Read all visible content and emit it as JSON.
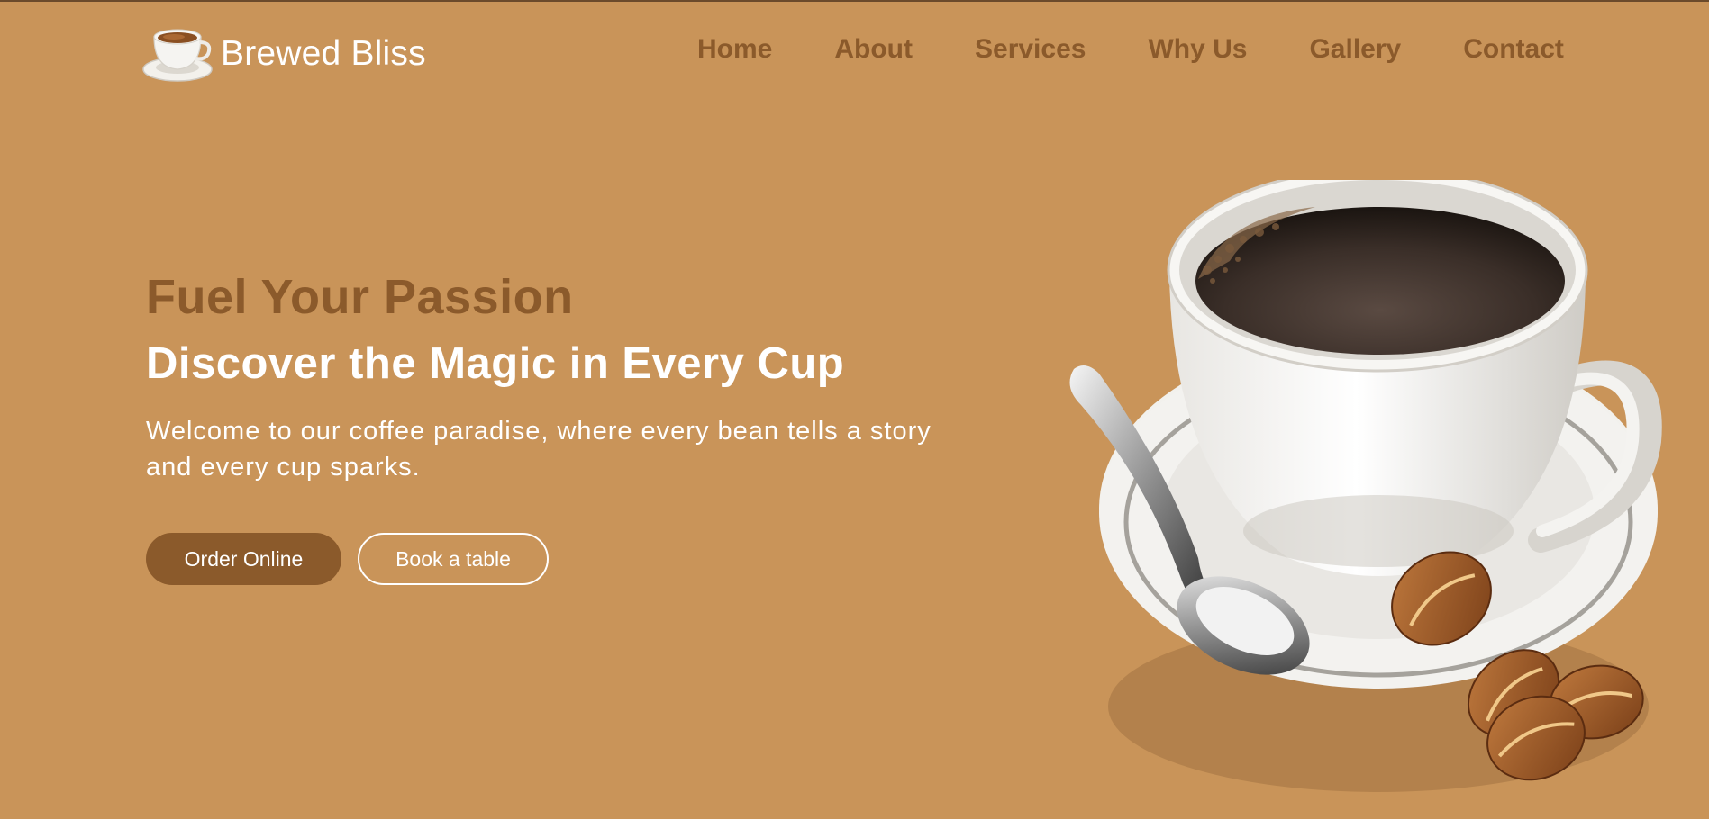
{
  "brand": {
    "name": "Brewed Bliss",
    "logo_icon": "coffee-cup-icon"
  },
  "nav": {
    "items": [
      {
        "label": "Home"
      },
      {
        "label": "About"
      },
      {
        "label": "Services"
      },
      {
        "label": "Why Us"
      },
      {
        "label": "Gallery"
      },
      {
        "label": "Contact"
      }
    ]
  },
  "hero": {
    "tagline": "Fuel Your Passion",
    "headline": "Discover the Magic in Every Cup",
    "description": "Welcome to our coffee paradise, where every bean tells a story and every cup sparks.",
    "primary_button": "Order Online",
    "secondary_button": "Book a table",
    "illustration_icon": "coffee-cup-with-spoon-and-beans-icon"
  },
  "colors": {
    "background": "#c99459",
    "accent": "#8b5a2b",
    "text_light": "#ffffff"
  }
}
